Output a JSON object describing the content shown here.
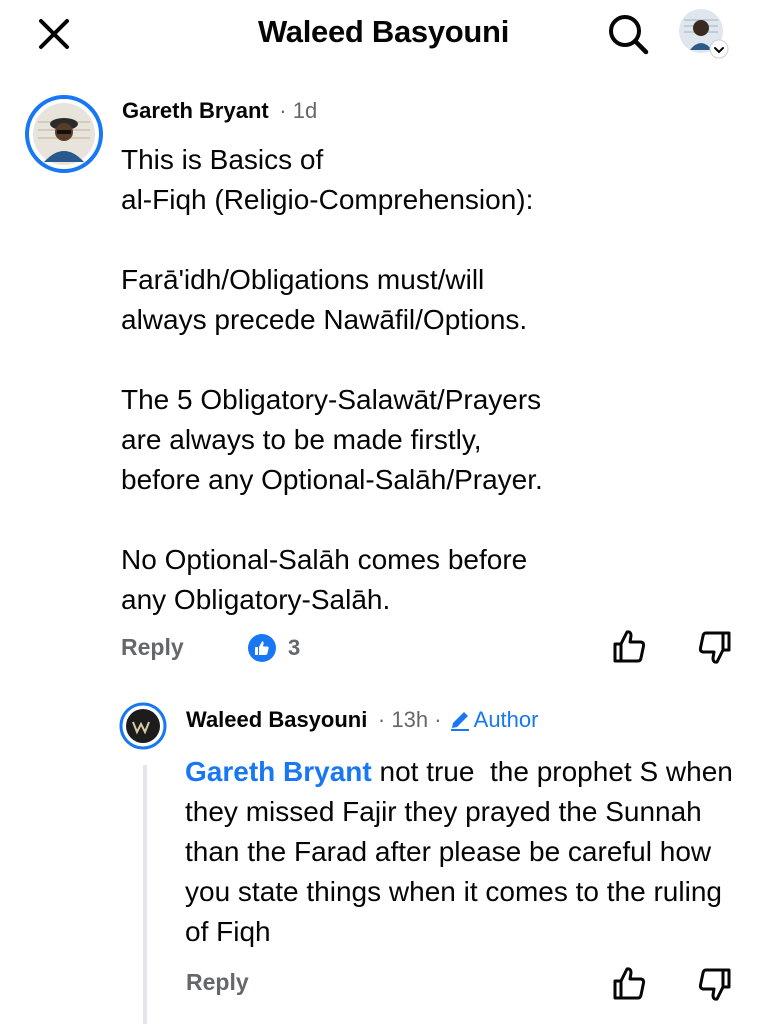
{
  "header": {
    "title": "Waleed Basyouni"
  },
  "comment1": {
    "author": "Gareth Bryant",
    "time": "1d",
    "body": [
      "This is Basics of\nal-Fiqh (Religio-Comprehension):",
      "Farā'idh/Obligations must/will\nalways precede Nawāfil/Options.",
      "The 5 Obligatory-Salawāt/Prayers\nare always to be made firstly,\nbefore any Optional-Salāh/Prayer.",
      "No Optional-Salāh comes before\nany Obligatory-Salāh."
    ],
    "reply_label": "Reply",
    "like_count": "3"
  },
  "comment2": {
    "author": "Waleed Basyouni",
    "time": "13h",
    "author_badge": "Author",
    "mention": "Gareth Bryant",
    "body": " not true  the prophet S when they missed Fajir they prayed the Sunnah than the Farad after please be careful how you state things when it comes to the ruling of Fiqh",
    "reply_label": "Reply"
  },
  "colors": {
    "accent": "#1877f2",
    "secondary_text": "#65676b",
    "thread_line": "#e4e6eb"
  },
  "icons": [
    "close-icon",
    "search-icon",
    "chevron-down-icon",
    "like-icon",
    "thumbs-up-icon",
    "thumbs-down-icon",
    "pencil-icon"
  ]
}
